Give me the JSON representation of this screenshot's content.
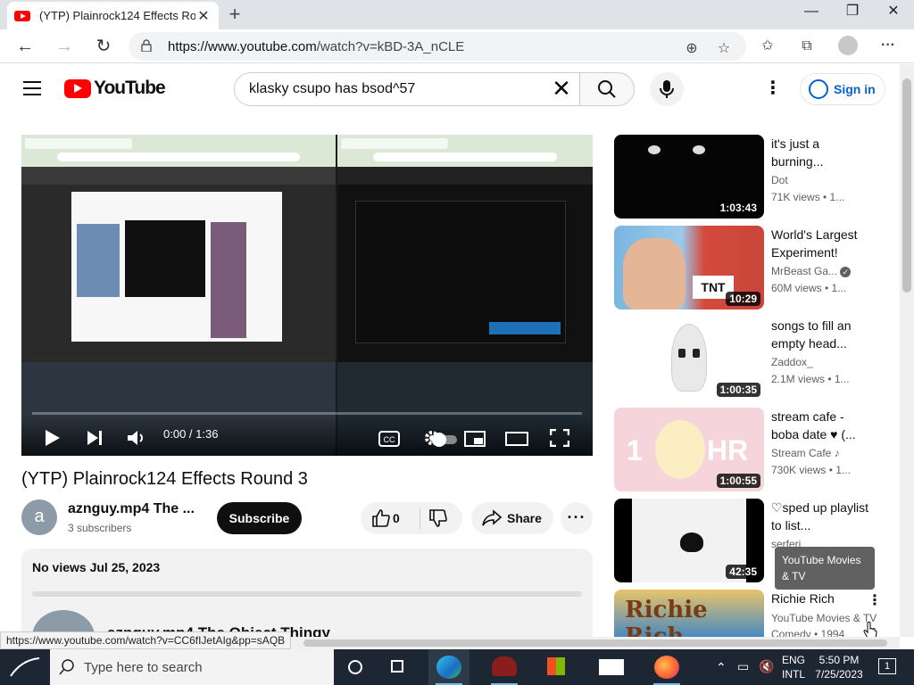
{
  "browser": {
    "tab_title": "(YTP) Plainrock124 Effects Round 3 - YouTube",
    "url_prefix": "https://www.youtube.com",
    "url_path": "/watch?v=kBD-3A_nCLE",
    "status_url": "https://www.youtube.com/watch?v=CC6fIJetAIg&pp=sAQB"
  },
  "youtube": {
    "logo_text": "YouTube",
    "search_query": "klasky csupo has bsod^57",
    "sign_in": "Sign in"
  },
  "player": {
    "time": "0:00 / 1:36",
    "progress": 0
  },
  "video": {
    "title": "(YTP) Plainrock124 Effects Round 3",
    "channel_initial": "a",
    "channel_name": "aznguy.mp4 The ...",
    "subscribers": "3 subscribers",
    "subscribe_label": "Subscribe",
    "like_count": "0",
    "share_label": "Share",
    "description_meta": "No views  Jul 25, 2023",
    "comment_author": "aznguy.mp4 The Object Thingy"
  },
  "recommendations": [
    {
      "title": "it's just a burning...",
      "channel": "Dot",
      "views": "71K views • 1...",
      "duration": "1:03:43",
      "thumb_color": "#0a0a0a"
    },
    {
      "title": "World's Largest Experiment!",
      "channel": "MrBeast Ga...",
      "views": "60M views • 1...",
      "duration": "10:29",
      "thumb_color": "#c8463a"
    },
    {
      "title": "songs to fill an empty head...",
      "channel": "Zaddox_",
      "views": "2.1M views • 1...",
      "duration": "1:00:35",
      "thumb_color": "#ffffff"
    },
    {
      "title": "stream cafe - boba date ♥ (...",
      "channel": "Stream Cafe",
      "views": "730K views • 1...",
      "duration": "1:00:55",
      "thumb_color": "#f6d4dc"
    },
    {
      "title": "♡sped up playlist to list...",
      "channel": "serferi",
      "views": "",
      "duration": "42:35",
      "thumb_color": "#f2f2f2"
    },
    {
      "title": "Richie Rich",
      "channel": "YouTube Movies & TV",
      "views": "Comedy • 1994",
      "duration": "",
      "thumb_color": "#3d86c6"
    }
  ],
  "tooltip": "YouTube Movies & TV",
  "taskbar": {
    "search_placeholder": "Type here to search",
    "lang_top": "ENG",
    "lang_bottom": "INTL",
    "time": "5:50 PM",
    "date": "7/25/2023",
    "notifications": "1"
  },
  "colors": {
    "youtube_red": "#ff0000",
    "link_blue": "#065fd4",
    "taskbar": "#1d2733"
  }
}
